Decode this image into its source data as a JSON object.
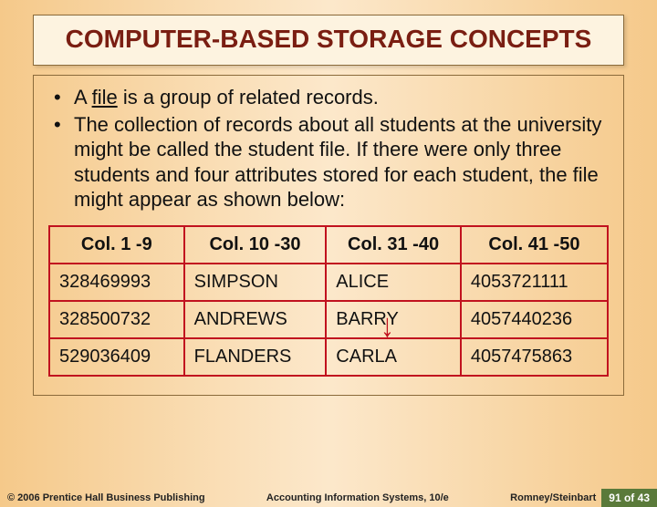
{
  "title": "COMPUTER-BASED STORAGE CONCEPTS",
  "bullets": [
    {
      "prefix": "A ",
      "underlined": "file",
      "suffix": " is a group of related records."
    },
    {
      "text": "The collection of records about all students at the university might be called the student file.  If there were only three students and four attributes stored for each student, the file might appear as shown below:"
    }
  ],
  "chart_data": {
    "type": "table",
    "headers": [
      "Col. 1 -9",
      "Col. 10 -30",
      "Col. 31 -40",
      "Col. 41 -50"
    ],
    "rows": [
      [
        "328469993",
        "SIMPSON",
        "ALICE",
        "4053721111"
      ],
      [
        "328500732",
        "ANDREWS",
        "BARRY",
        "4057440236"
      ],
      [
        "529036409",
        "FLANDERS",
        "CARLA",
        "4057475863"
      ]
    ]
  },
  "footer": {
    "copyright": "© 2006 Prentice Hall Business Publishing",
    "center": "Accounting Information Systems, 10/e",
    "authors": "Romney/Steinbart",
    "page": "91 of 43"
  }
}
